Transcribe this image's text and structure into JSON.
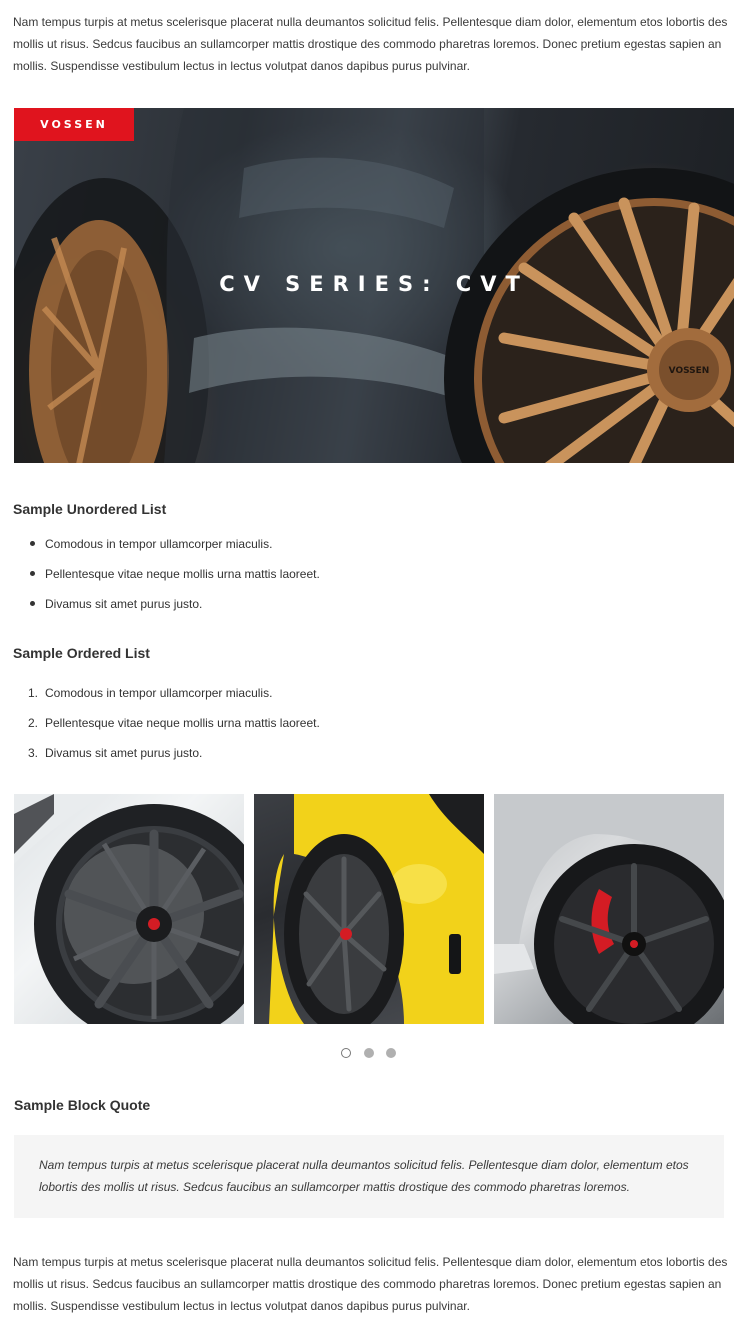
{
  "intro_paragraph": "Nam tempus turpis at metus scelerisque placerat nulla deumantos solicitud felis. Pellentesque diam dolor, elementum etos lobortis des mollis ut risus. Sedcus faucibus an sullamcorper mattis drostique des commodo pharetras loremos. Donec pretium egestas sapien an mollis. Suspendisse vestibulum lectus in lectus volutpat danos dapibus purus pulvinar.",
  "hero": {
    "brand": "VOSSEN",
    "title": "CV SERIES: CVT",
    "hub_text": "VOSSEN"
  },
  "unordered_list": {
    "heading": "Sample Unordered List",
    "items": [
      "Comodous in tempor ullamcorper miaculis.",
      "Pellentesque vitae neque mollis urna mattis laoreet.",
      "Divamus sit amet purus justo."
    ]
  },
  "ordered_list": {
    "heading": "Sample Ordered List",
    "items": [
      {
        "number": "1.",
        "text": "Comodous in tempor ullamcorper miaculis."
      },
      {
        "number": "2.",
        "text": "Pellentesque vitae neque mollis urna mattis laoreet."
      },
      {
        "number": "3.",
        "text": "Divamus sit amet purus justo."
      }
    ]
  },
  "gallery": {
    "slides": 3,
    "active_slide": 1
  },
  "block_quote": {
    "heading": "Sample Block Quote",
    "text": "Nam tempus turpis at metus scelerisque placerat nulla deumantos solicitud felis. Pellentesque diam dolor, elementum etos lobortis des mollis ut risus. Sedcus faucibus an sullamcorper mattis drostique des commodo pharetras loremos."
  },
  "outro_paragraph": "Nam tempus turpis at metus scelerisque placerat nulla deumantos solicitud felis. Pellentesque diam dolor, elementum etos lobortis des mollis ut risus. Sedcus faucibus an sullamcorper mattis drostique des commodo pharetras loremos. Donec pretium egestas sapien an mollis. Suspendisse vestibulum lectus in lectus volutpat danos dapibus purus pulvinar.",
  "colors": {
    "brand_red": "#e0141e",
    "wheel_bronze": "#b07a48",
    "yellow_car": "#f2d21a",
    "caliper_red": "#d41c24"
  }
}
